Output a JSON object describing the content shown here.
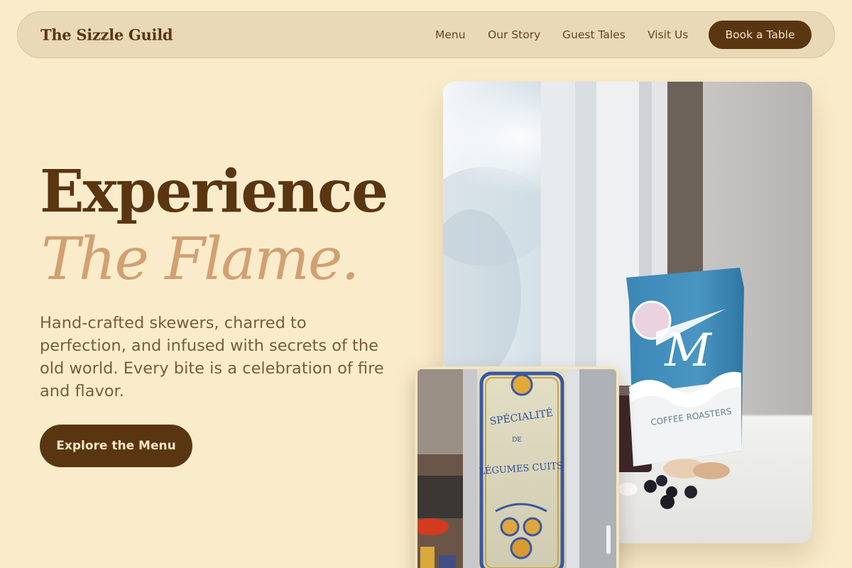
{
  "nav": {
    "brand": "The Sizzle Guild",
    "links": [
      "Menu",
      "Our Story",
      "Guest Tales",
      "Visit Us"
    ],
    "cta": "Book a Table"
  },
  "hero": {
    "headline": "Experience",
    "headline_accent": "The Flame.",
    "description": "Hand-crafted skewers, charred to perfection, and infused with secrets of the old world. Every bite is a celebration of fire and flavor.",
    "cta": "Explore the Menu"
  },
  "images": {
    "main_photo": {
      "bag_brand": "M",
      "bag_text": "COFFEE ROASTERS"
    },
    "secondary_photo": {
      "sign_line_1": "SPÉCIALITÉ",
      "sign_line_2": "DE",
      "sign_line_3": "LÉGUMES CUITS"
    }
  },
  "colors": {
    "background": "#faecca",
    "nav_background": "#e9d9b6",
    "primary": "#5a3512",
    "accent": "#d2a072",
    "body_text": "#7a5b40"
  }
}
